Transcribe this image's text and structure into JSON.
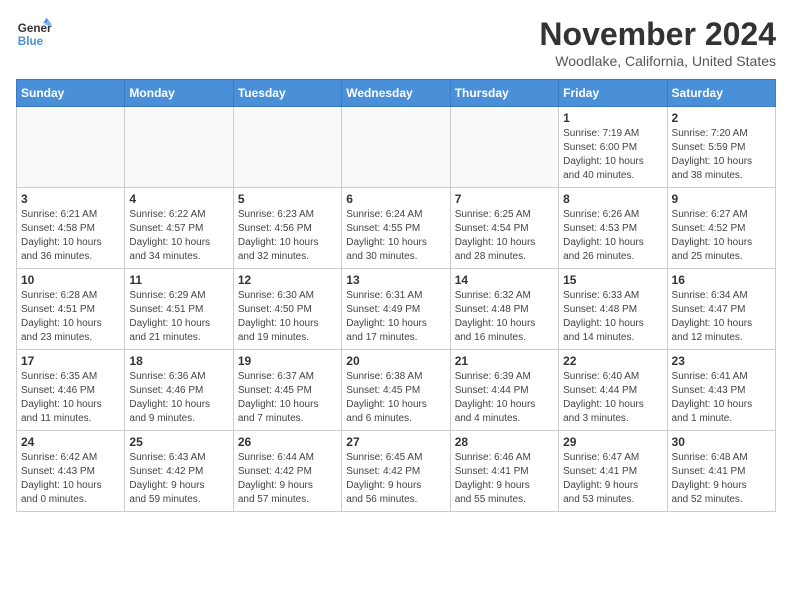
{
  "logo": {
    "text_general": "General",
    "text_blue": "Blue"
  },
  "header": {
    "month": "November 2024",
    "location": "Woodlake, California, United States"
  },
  "weekdays": [
    "Sunday",
    "Monday",
    "Tuesday",
    "Wednesday",
    "Thursday",
    "Friday",
    "Saturday"
  ],
  "weeks": [
    [
      {
        "day": "",
        "info": ""
      },
      {
        "day": "",
        "info": ""
      },
      {
        "day": "",
        "info": ""
      },
      {
        "day": "",
        "info": ""
      },
      {
        "day": "",
        "info": ""
      },
      {
        "day": "1",
        "info": "Sunrise: 7:19 AM\nSunset: 6:00 PM\nDaylight: 10 hours\nand 40 minutes."
      },
      {
        "day": "2",
        "info": "Sunrise: 7:20 AM\nSunset: 5:59 PM\nDaylight: 10 hours\nand 38 minutes."
      }
    ],
    [
      {
        "day": "3",
        "info": "Sunrise: 6:21 AM\nSunset: 4:58 PM\nDaylight: 10 hours\nand 36 minutes."
      },
      {
        "day": "4",
        "info": "Sunrise: 6:22 AM\nSunset: 4:57 PM\nDaylight: 10 hours\nand 34 minutes."
      },
      {
        "day": "5",
        "info": "Sunrise: 6:23 AM\nSunset: 4:56 PM\nDaylight: 10 hours\nand 32 minutes."
      },
      {
        "day": "6",
        "info": "Sunrise: 6:24 AM\nSunset: 4:55 PM\nDaylight: 10 hours\nand 30 minutes."
      },
      {
        "day": "7",
        "info": "Sunrise: 6:25 AM\nSunset: 4:54 PM\nDaylight: 10 hours\nand 28 minutes."
      },
      {
        "day": "8",
        "info": "Sunrise: 6:26 AM\nSunset: 4:53 PM\nDaylight: 10 hours\nand 26 minutes."
      },
      {
        "day": "9",
        "info": "Sunrise: 6:27 AM\nSunset: 4:52 PM\nDaylight: 10 hours\nand 25 minutes."
      }
    ],
    [
      {
        "day": "10",
        "info": "Sunrise: 6:28 AM\nSunset: 4:51 PM\nDaylight: 10 hours\nand 23 minutes."
      },
      {
        "day": "11",
        "info": "Sunrise: 6:29 AM\nSunset: 4:51 PM\nDaylight: 10 hours\nand 21 minutes."
      },
      {
        "day": "12",
        "info": "Sunrise: 6:30 AM\nSunset: 4:50 PM\nDaylight: 10 hours\nand 19 minutes."
      },
      {
        "day": "13",
        "info": "Sunrise: 6:31 AM\nSunset: 4:49 PM\nDaylight: 10 hours\nand 17 minutes."
      },
      {
        "day": "14",
        "info": "Sunrise: 6:32 AM\nSunset: 4:48 PM\nDaylight: 10 hours\nand 16 minutes."
      },
      {
        "day": "15",
        "info": "Sunrise: 6:33 AM\nSunset: 4:48 PM\nDaylight: 10 hours\nand 14 minutes."
      },
      {
        "day": "16",
        "info": "Sunrise: 6:34 AM\nSunset: 4:47 PM\nDaylight: 10 hours\nand 12 minutes."
      }
    ],
    [
      {
        "day": "17",
        "info": "Sunrise: 6:35 AM\nSunset: 4:46 PM\nDaylight: 10 hours\nand 11 minutes."
      },
      {
        "day": "18",
        "info": "Sunrise: 6:36 AM\nSunset: 4:46 PM\nDaylight: 10 hours\nand 9 minutes."
      },
      {
        "day": "19",
        "info": "Sunrise: 6:37 AM\nSunset: 4:45 PM\nDaylight: 10 hours\nand 7 minutes."
      },
      {
        "day": "20",
        "info": "Sunrise: 6:38 AM\nSunset: 4:45 PM\nDaylight: 10 hours\nand 6 minutes."
      },
      {
        "day": "21",
        "info": "Sunrise: 6:39 AM\nSunset: 4:44 PM\nDaylight: 10 hours\nand 4 minutes."
      },
      {
        "day": "22",
        "info": "Sunrise: 6:40 AM\nSunset: 4:44 PM\nDaylight: 10 hours\nand 3 minutes."
      },
      {
        "day": "23",
        "info": "Sunrise: 6:41 AM\nSunset: 4:43 PM\nDaylight: 10 hours\nand 1 minute."
      }
    ],
    [
      {
        "day": "24",
        "info": "Sunrise: 6:42 AM\nSunset: 4:43 PM\nDaylight: 10 hours\nand 0 minutes."
      },
      {
        "day": "25",
        "info": "Sunrise: 6:43 AM\nSunset: 4:42 PM\nDaylight: 9 hours\nand 59 minutes."
      },
      {
        "day": "26",
        "info": "Sunrise: 6:44 AM\nSunset: 4:42 PM\nDaylight: 9 hours\nand 57 minutes."
      },
      {
        "day": "27",
        "info": "Sunrise: 6:45 AM\nSunset: 4:42 PM\nDaylight: 9 hours\nand 56 minutes."
      },
      {
        "day": "28",
        "info": "Sunrise: 6:46 AM\nSunset: 4:41 PM\nDaylight: 9 hours\nand 55 minutes."
      },
      {
        "day": "29",
        "info": "Sunrise: 6:47 AM\nSunset: 4:41 PM\nDaylight: 9 hours\nand 53 minutes."
      },
      {
        "day": "30",
        "info": "Sunrise: 6:48 AM\nSunset: 4:41 PM\nDaylight: 9 hours\nand 52 minutes."
      }
    ]
  ]
}
